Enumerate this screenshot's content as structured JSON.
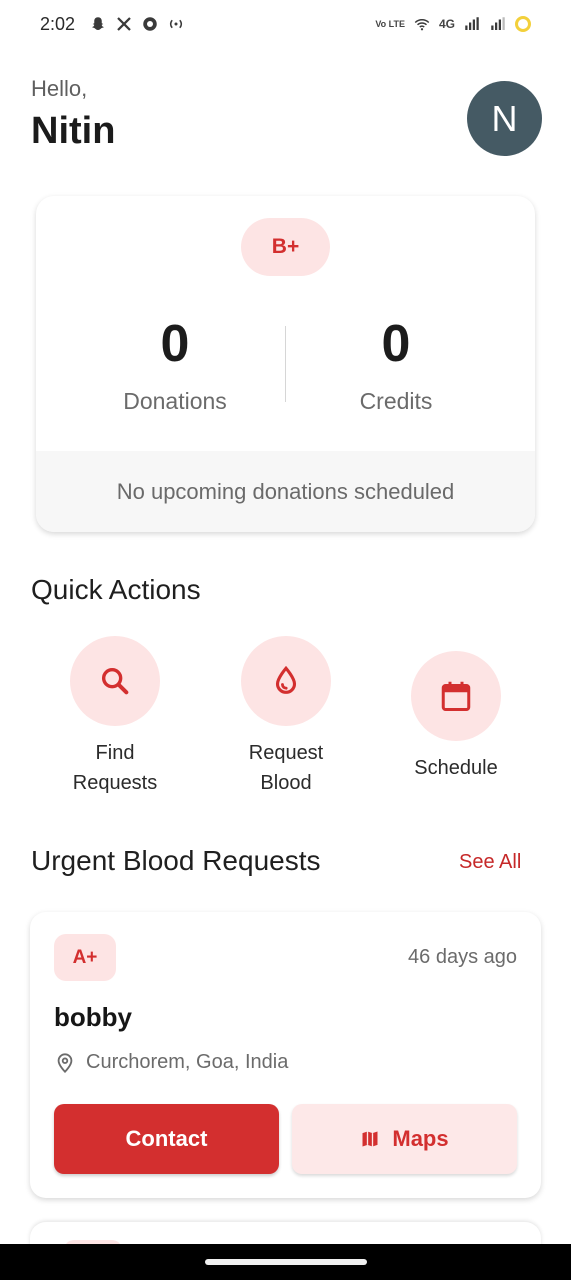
{
  "status_bar": {
    "time": "2:02",
    "network": "4G"
  },
  "greeting": {
    "hello": "Hello,",
    "name": "Nitin",
    "avatar_initial": "N"
  },
  "summary": {
    "blood_type": "B+",
    "donations_value": "0",
    "donations_label": "Donations",
    "credits_value": "0",
    "credits_label": "Credits",
    "upcoming_text": "No upcoming donations scheduled"
  },
  "quick_actions": {
    "title": "Quick Actions",
    "items": [
      {
        "label": "Find\nRequests",
        "icon": "search-icon"
      },
      {
        "label": "Request\nBlood",
        "icon": "blood-drop-icon"
      },
      {
        "label": "Schedule",
        "icon": "calendar-icon"
      }
    ]
  },
  "urgent": {
    "title": "Urgent Blood Requests",
    "see_all": "See All",
    "requests": [
      {
        "blood_type": "A+",
        "time_ago": "46 days ago",
        "name": "bobby",
        "location": "Curchorem, Goa, India",
        "contact_label": "Contact",
        "maps_label": "Maps"
      }
    ]
  },
  "colors": {
    "accent": "#d32f2f",
    "accent_light": "#fde4e4",
    "avatar_bg": "#455a64"
  }
}
